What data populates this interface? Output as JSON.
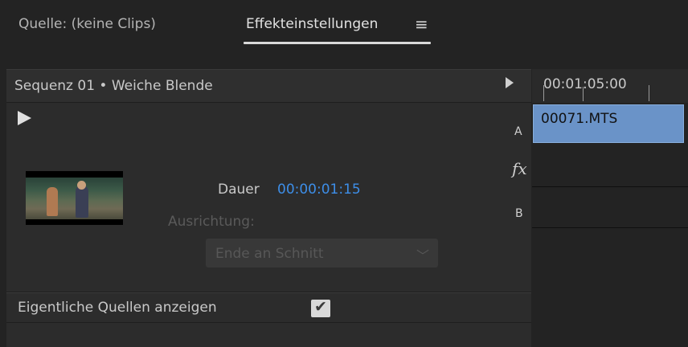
{
  "tabs": {
    "source": "Quelle: (keine Clips)",
    "effect_controls": "Effekteinstellungen",
    "menu_icon": "≡"
  },
  "sequence": {
    "title": "Sequenz 01 • Weiche Blende"
  },
  "side_labels": {
    "a": "A",
    "fx": "fx",
    "b": "B"
  },
  "transition": {
    "duration_label": "Dauer",
    "duration_value": "00:00:01:15",
    "alignment_label": "Ausrichtung:",
    "alignment_value": "Ende an Schnitt",
    "show_sources_label": "Eigentliche Quellen anzeigen",
    "show_sources_checked": true
  },
  "timeline": {
    "timecode": "00:01:05:00",
    "clip_name": "00071.MTS"
  },
  "colors": {
    "timecode_blue": "#3d8ee8",
    "clip_blue": "#6a93c8"
  }
}
